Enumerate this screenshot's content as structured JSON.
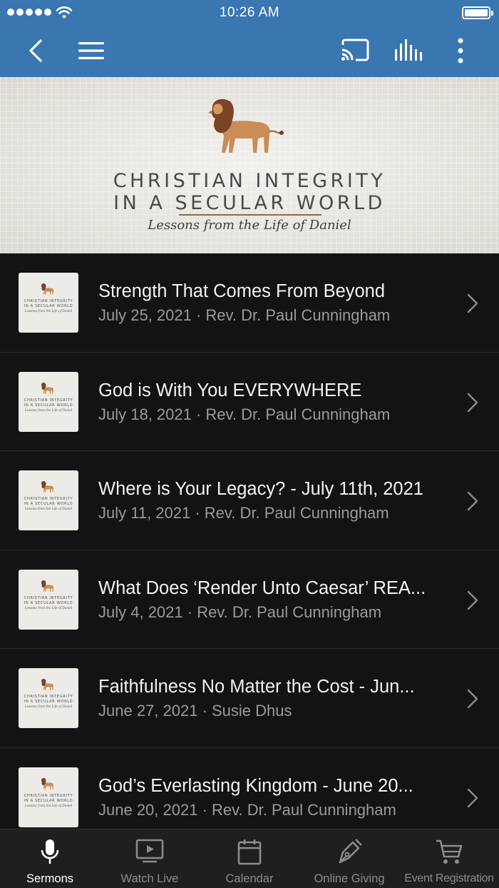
{
  "status_bar": {
    "time": "10:26 AM"
  },
  "banner": {
    "title_line1": "CHRISTIAN INTEGRITY",
    "title_line2": "IN A SECULAR WORLD",
    "subtitle": "Lessons from the Life of Daniel"
  },
  "thumbnail": {
    "line1": "CHRISTIAN INTEGRITY",
    "line2": "IN A SECULAR WORLD",
    "line3": "Lessons from the Life of Daniel"
  },
  "sermons": [
    {
      "title": "Strength That Comes From Beyond",
      "subtitle": "July 25, 2021 · Rev. Dr. Paul Cunningham"
    },
    {
      "title": "God is With You EVERYWHERE",
      "subtitle": "July 18, 2021 · Rev. Dr. Paul Cunningham"
    },
    {
      "title": "Where is Your Legacy? - July 11th, 2021",
      "subtitle": "July 11, 2021 · Rev. Dr. Paul Cunningham"
    },
    {
      "title": "What Does ‘Render Unto Caesar’ REA...",
      "subtitle": "July 4, 2021 · Rev. Dr. Paul Cunningham"
    },
    {
      "title": "Faithfulness No Matter the Cost - Jun...",
      "subtitle": "June 27, 2021 · Susie Dhus"
    },
    {
      "title": "God’s Everlasting Kingdom - June 20...",
      "subtitle": "June 20, 2021 · Rev. Dr. Paul Cunningham"
    }
  ],
  "tabs": [
    {
      "label": "Sermons",
      "icon": "microphone-icon",
      "active": true
    },
    {
      "label": "Watch Live",
      "icon": "tv-play-icon",
      "active": false
    },
    {
      "label": "Calendar",
      "icon": "calendar-icon",
      "active": false
    },
    {
      "label": "Online Giving",
      "icon": "pen-nib-icon",
      "active": false
    },
    {
      "label": "Event Registration",
      "icon": "cart-icon",
      "active": false
    }
  ],
  "colors": {
    "nav_blue": "#3a76b0",
    "list_bg": "#131315",
    "tab_bar": "#1f1f21"
  }
}
